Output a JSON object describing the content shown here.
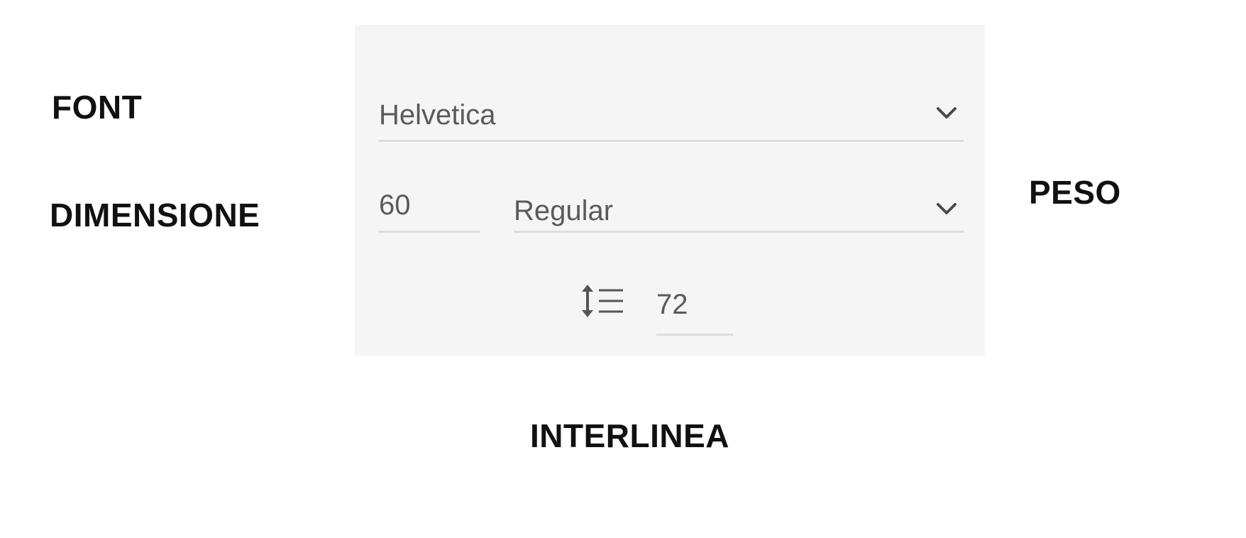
{
  "annotations": {
    "font": "FONT",
    "dimensione": "DIMENSIONE",
    "peso": "PESO",
    "interlinea": "INTERLINEA"
  },
  "panel": {
    "font_family": {
      "value": "Helvetica",
      "icon": "chevron-down-icon"
    },
    "font_size": {
      "value": "60"
    },
    "font_weight": {
      "value": "Regular",
      "icon": "chevron-down-icon"
    },
    "line_height": {
      "value": "72",
      "icon": "line-spacing-icon"
    }
  },
  "colors": {
    "panel_background": "#f5f5f5",
    "field_text": "#5a5a5a",
    "underline": "#dcdcdc",
    "annotation_text": "#111111"
  }
}
